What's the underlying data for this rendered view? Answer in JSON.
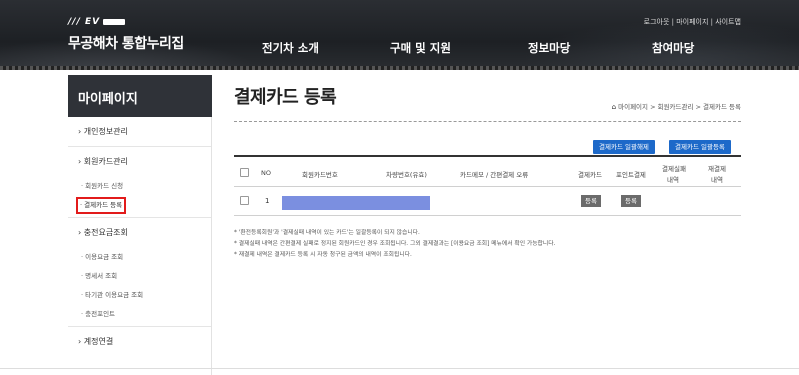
{
  "header": {
    "logo_ev": "/// EV",
    "logo_title": "무공해차 통합누리집",
    "util_links": "로그아웃 | 마이페이지 | 사이트맵",
    "gnb": [
      "전기차 소개",
      "구매 및 지원",
      "정보마당",
      "참여마당"
    ]
  },
  "sidebar": {
    "title": "마이페이지",
    "menu1": "› 개인정보관리",
    "menu2": "› 회원카드관리",
    "sub2_1": "· 회원카드 신청",
    "sub2_2": "· 결제카드 등록",
    "menu3": "› 충전요금조회",
    "sub3_1": "· 이용요금 조회",
    "sub3_2": "· 명세서 조회",
    "sub3_3": "· 타기관 이용요금 조회",
    "sub3_4": "· 충전포인트",
    "menu4": "› 계정연결"
  },
  "main": {
    "title": "결제카드 등록",
    "breadcrumb": "마이페이지 > 회원카드관리 > 결제카드 등록",
    "btn_bulk_cancel": "결제카드 일괄해제",
    "btn_bulk_register": "결제카드 일괄등록",
    "columns": {
      "no": "NO",
      "card_no": "회원카드번호",
      "car_no": "차량번호(유효)",
      "card_memo": "카드메모 / 간편결제 오류",
      "pay_card": "결제카드",
      "point_pay": "포인트결제",
      "fail_1": "결제실패",
      "fail_2": "내역",
      "repay_1": "재결제",
      "repay_2": "내역"
    },
    "row": {
      "no": "1",
      "btn_register_1": "등록",
      "btn_register_2": "등록"
    },
    "notes": [
      "* '환전등록회원'과 '결제실패 내역이 있는 카드'는 일괄등록이 되지 않습니다.",
      "* 결제실패 내역은 간편결제 실패로 정지된 회원카드인 경우 조회됩니다. 그외 결제결과는 [이용요금 조회] 메뉴에서 확인 가능합니다.",
      "* 재결제 내역은 결제카드 등록 시 자동 청구된 금액의 내역이 조회됩니다."
    ]
  },
  "colors": {
    "header_bg": "#1d2024",
    "sidebar_title_bg": "#2f3238",
    "accent_blue": "#1d69c9",
    "highlight_red": "#e21b1b",
    "button_gray": "#6b6b6b"
  }
}
